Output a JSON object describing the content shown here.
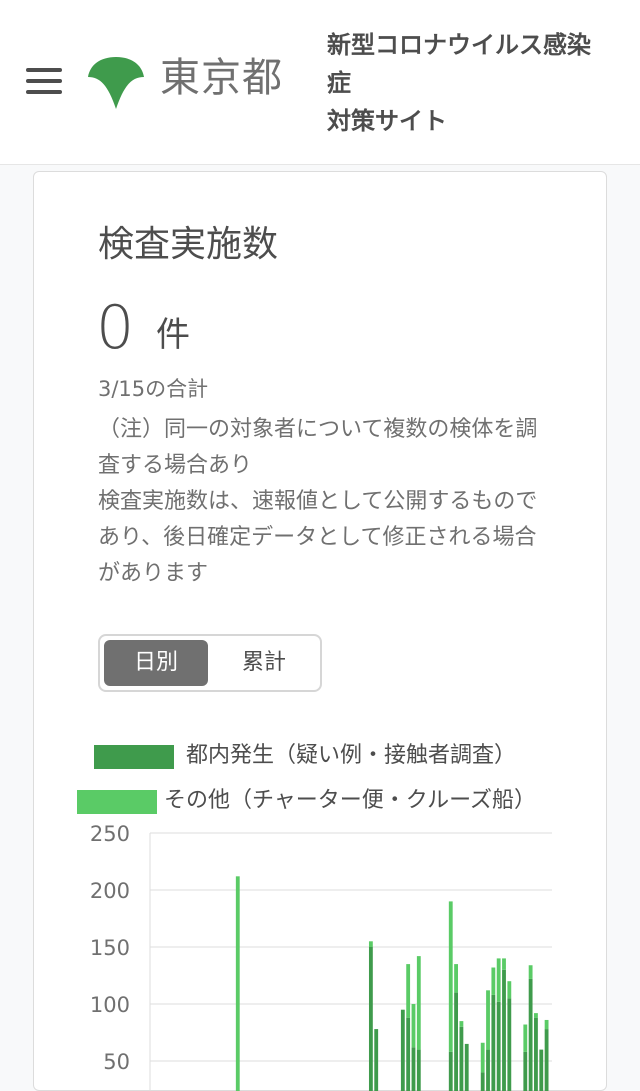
{
  "header": {
    "logo_text": "東京都",
    "site_title_lines": [
      "新型コロナウイルス感染",
      "症",
      "対策サイト"
    ]
  },
  "card": {
    "title": "検査実施数",
    "value": "0",
    "unit": "件",
    "date_label": "3/15の合計",
    "notes": [
      "（注）同一の対象者について複数の検体を調査する場合あり",
      "検査実施数は、速報値として公開するものであり、後日確定データとして修正される場合があります"
    ],
    "toggle": {
      "daily": "日別",
      "cumulative": "累計"
    }
  },
  "colors": {
    "series_inside": "#3f9b4c",
    "series_other": "#5acb66",
    "text": "#4d4d4d"
  },
  "chart_data": {
    "type": "bar",
    "stacked": true,
    "legend": [
      "都内発生（疑い例・接触者調査）",
      "その他（チャーター便・クルーズ船）"
    ],
    "y_ticks": [
      "250",
      "200",
      "150",
      "100",
      "50"
    ],
    "ylim": [
      0,
      250
    ],
    "series": [
      {
        "name": "都内発生（疑い例・接触者調査）",
        "values": [
          0,
          0,
          0,
          0,
          0,
          0,
          0,
          0,
          0,
          0,
          0,
          0,
          0,
          0,
          0,
          0,
          0,
          0,
          0,
          0,
          0,
          0,
          0,
          0,
          0,
          0,
          0,
          0,
          0,
          0,
          0,
          0,
          0,
          0,
          0,
          0,
          0,
          0,
          0,
          0,
          150,
          78,
          0,
          0,
          0,
          0,
          95,
          88,
          62,
          60,
          0,
          0,
          0,
          0,
          0,
          58,
          110,
          80,
          65,
          0,
          0,
          40,
          60,
          108,
          102,
          130,
          105,
          0,
          0,
          58,
          122,
          88,
          60,
          78
        ]
      },
      {
        "name": "その他（チャーター便・クルーズ船）",
        "values": [
          0,
          0,
          0,
          0,
          0,
          0,
          0,
          0,
          0,
          0,
          0,
          0,
          0,
          0,
          0,
          212,
          0,
          0,
          0,
          0,
          0,
          1,
          0,
          0,
          0,
          0,
          0,
          0,
          0,
          0,
          0,
          0,
          0,
          0,
          0,
          0,
          0,
          0,
          0,
          0,
          5,
          0,
          0,
          0,
          0,
          0,
          0,
          47,
          38,
          82,
          0,
          0,
          0,
          0,
          0,
          132,
          25,
          5,
          0,
          0,
          0,
          26,
          52,
          24,
          38,
          10,
          15,
          0,
          0,
          24,
          12,
          4,
          0,
          8
        ]
      }
    ]
  }
}
